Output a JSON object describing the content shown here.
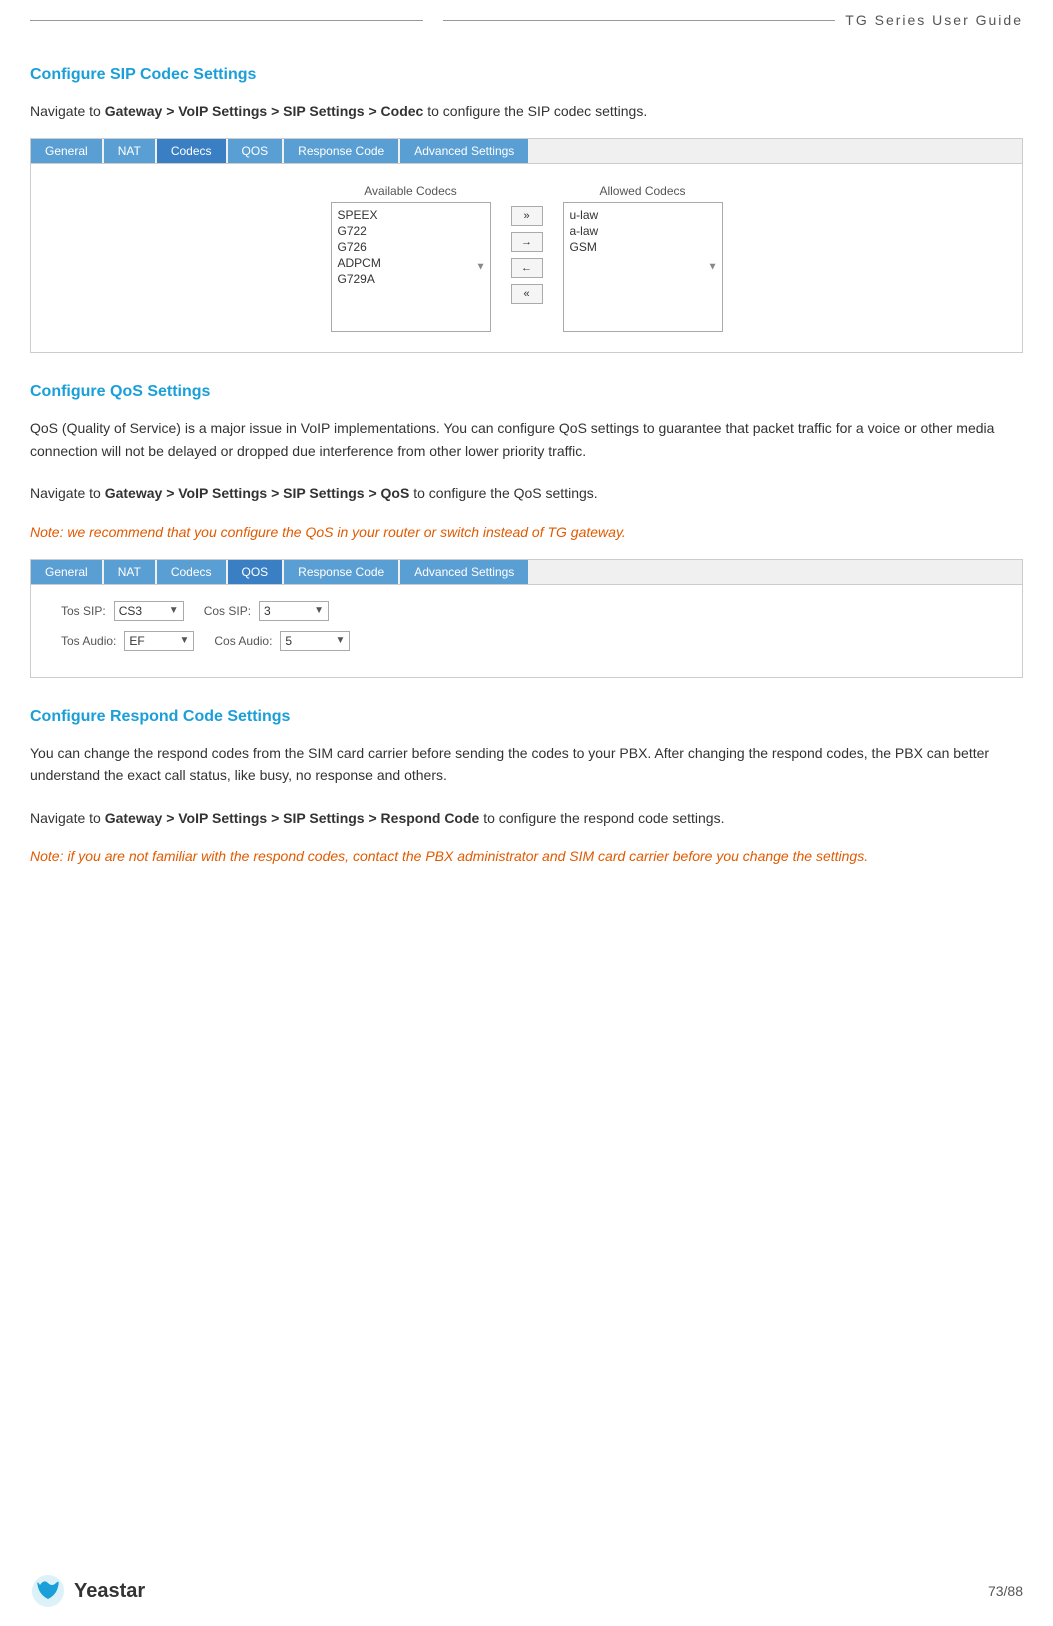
{
  "header": {
    "title": "TG  Series  User  Guide",
    "line1": "",
    "line2": "",
    "line3": ""
  },
  "sections": {
    "codec": {
      "title": "Configure SIP Codec Settings",
      "nav_text_prefix": "Navigate  to ",
      "nav_bold": "Gateway > VoIP  Settings > SIP Settings > Codec",
      "nav_text_suffix": " to  configure  the  SIP  codec settings.",
      "tabs": [
        "General",
        "NAT",
        "Codecs",
        "QOS",
        "Response Code",
        "Advanced Settings"
      ],
      "active_tab": "Codecs",
      "available_label": "Available Codecs",
      "allowed_label": "Allowed Codecs",
      "available_codecs": [
        "SPEEX",
        "G722",
        "G726",
        "ADPCM",
        "G729A"
      ],
      "allowed_codecs": [
        "u-law",
        "a-law",
        "GSM"
      ],
      "btn_double_right": "»",
      "btn_right": "→",
      "btn_left": "←",
      "btn_double_left": "«"
    },
    "qos": {
      "title": "Configure QoS Settings",
      "body1": "QoS (Quality of Service) is a major issue in VoIP implementations. You can configure QoS settings to guarantee that packet traffic for a voice or other media connection will not be delayed or dropped due interference from other lower priority traffic.",
      "nav_text_prefix": "Navigate  to ",
      "nav_bold": "Gateway > VoIP  Settings > SIP Settings > QoS",
      "nav_text_suffix": " to configure the QoS settings.",
      "note": "Note: we recommend that you configure the QoS in your router or switch instead of TG gateway.",
      "tabs": [
        "General",
        "NAT",
        "Codecs",
        "QOS",
        "Response Code",
        "Advanced Settings"
      ],
      "active_tab": "QOS",
      "fields": {
        "tos_sip_label": "Tos SIP:",
        "tos_sip_value": "CS3",
        "cos_sip_label": "Cos SIP:",
        "cos_sip_value": "3",
        "tos_audio_label": "Tos Audio:",
        "tos_audio_value": "EF",
        "cos_audio_label": "Cos Audio:",
        "cos_audio_value": "5"
      }
    },
    "respond": {
      "title": "Configure Respond Code Settings",
      "body1": "You can change the respond codes from the SIM card carrier before sending the codes to your PBX. After changing the respond codes, the PBX can better understand the exact call status, like busy, no response and others.",
      "nav_text_prefix": "Navigate to ",
      "nav_bold": "Gateway >  VoIP  Settings >  SIP Settings >  Respond Code",
      "nav_text_suffix": " to configure the respond code settings.",
      "note": "Note:  if  you  are  not  familiar  with  the  respond  codes,  contact  the  PBX  administrator  and  SIM  card carrier before you change the settings."
    }
  },
  "footer": {
    "logo_text": "Yeastar",
    "page_num": "73/88"
  }
}
